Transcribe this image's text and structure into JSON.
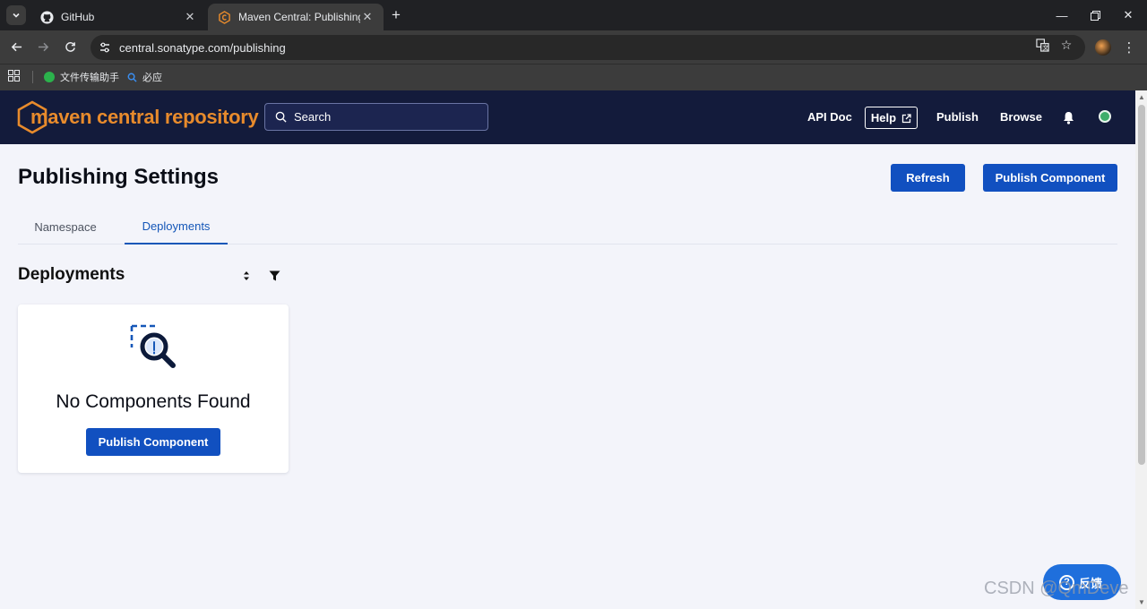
{
  "browser": {
    "tabs": [
      {
        "title": "GitHub",
        "icon": "github-icon",
        "active": false
      },
      {
        "title": "Maven Central: Publishing",
        "icon": "maven-central-favicon",
        "active": true
      }
    ],
    "url": "central.sonatype.com/publishing",
    "bookmarks": [
      {
        "label": "文件传输助手",
        "icon": "wechat-icon",
        "color": "#2bb24c"
      },
      {
        "label": "必应",
        "icon": "bing-search-icon",
        "color": "#3a8ef0"
      }
    ]
  },
  "header": {
    "logo_text": "maven central repository",
    "search_placeholder": "Search",
    "nav": {
      "api_doc": "API Doc",
      "help": "Help",
      "publish": "Publish",
      "browse": "Browse"
    }
  },
  "page": {
    "title": "Publishing Settings",
    "refresh_label": "Refresh",
    "publish_component_label": "Publish Component",
    "tabs": [
      {
        "label": "Namespace",
        "active": false
      },
      {
        "label": "Deployments",
        "active": true
      }
    ],
    "section_title": "Deployments",
    "empty_state": {
      "message": "No Components Found",
      "button_label": "Publish Component"
    }
  },
  "feedback": {
    "label": "反馈"
  },
  "watermark": "CSDN @QmDeve",
  "colors": {
    "header_bg": "#131b3b",
    "brand_orange": "#e88b2c",
    "primary_button": "#1150c0",
    "active_tab": "#1557b8",
    "page_bg": "#f3f4fa"
  }
}
